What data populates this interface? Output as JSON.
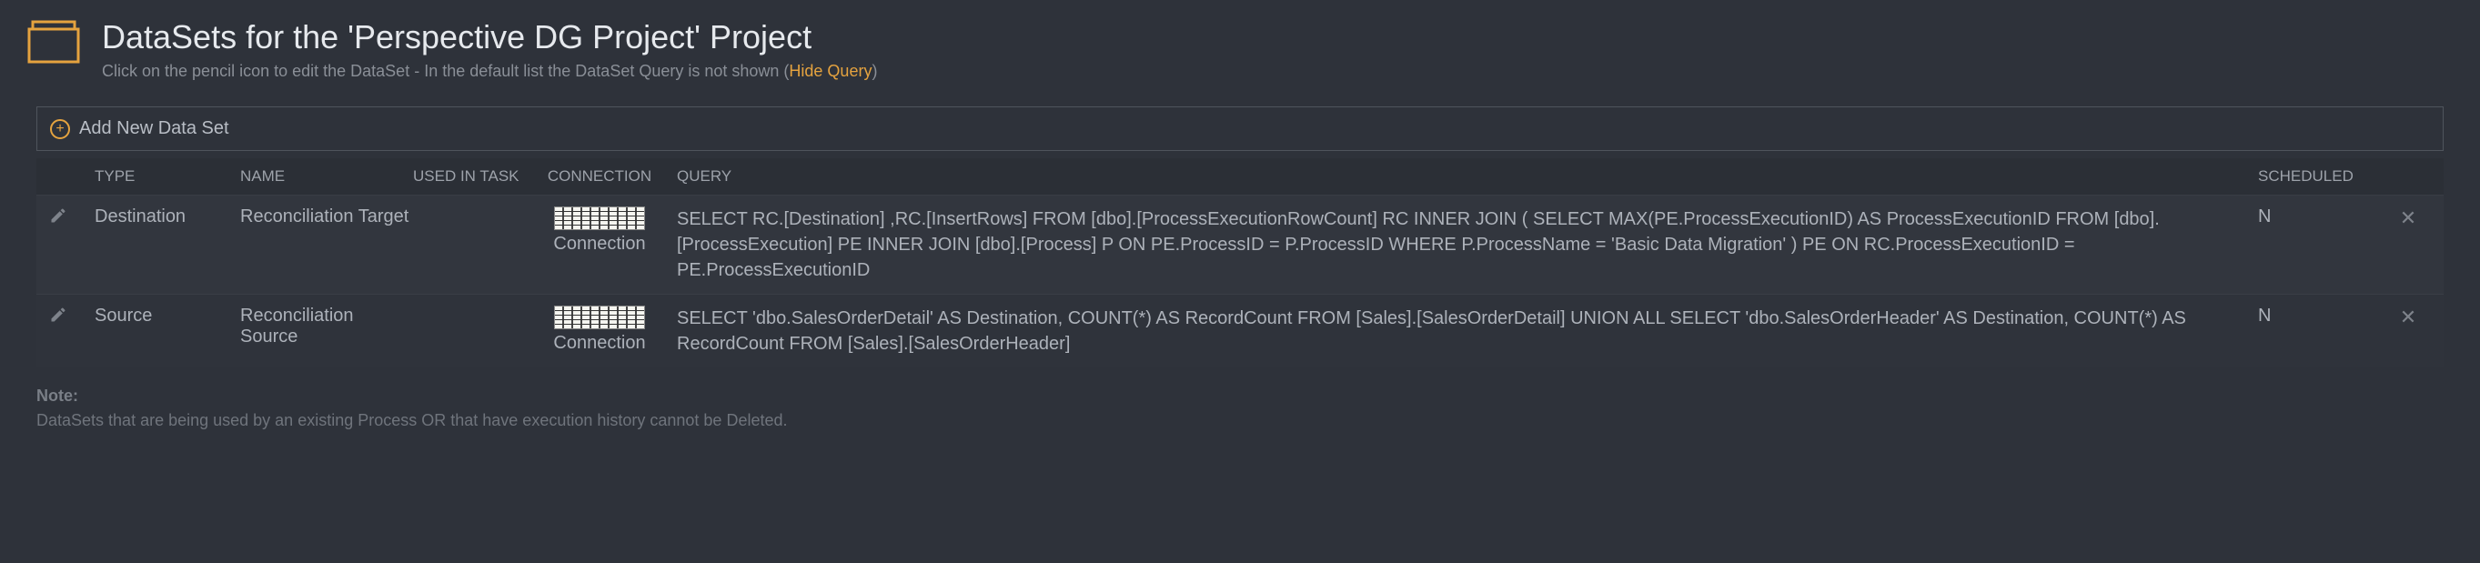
{
  "header": {
    "title": "DataSets for the 'Perspective DG Project' Project",
    "subtitle_prefix": "Click on the pencil icon to edit the DataSet - In the default list the DataSet Query is not shown (",
    "subtitle_link": "Hide Query",
    "subtitle_suffix": ")"
  },
  "toolbar": {
    "add_label": "Add New Data Set"
  },
  "table": {
    "headers": {
      "type": "TYPE",
      "name": "NAME",
      "used_in": "USED IN TASK",
      "connection": "CONNECTION",
      "query": "QUERY",
      "scheduled": "SCHEDULED"
    },
    "rows": [
      {
        "type": "Destination",
        "name": "Reconciliation Target",
        "used_in": "",
        "connection_label": "Connection",
        "query": "SELECT RC.[Destination] ,RC.[InsertRows] FROM [dbo].[ProcessExecutionRowCount] RC INNER JOIN ( SELECT MAX(PE.ProcessExecutionID) AS ProcessExecutionID FROM [dbo].[ProcessExecution] PE INNER JOIN [dbo].[Process] P ON PE.ProcessID = P.ProcessID WHERE P.ProcessName = 'Basic Data Migration' ) PE ON RC.ProcessExecutionID = PE.ProcessExecutionID",
        "scheduled": "N"
      },
      {
        "type": "Source",
        "name": "Reconciliation Source",
        "used_in": "",
        "connection_label": "Connection",
        "query": "SELECT 'dbo.SalesOrderDetail' AS Destination, COUNT(*) AS RecordCount FROM [Sales].[SalesOrderDetail] UNION ALL SELECT 'dbo.SalesOrderHeader' AS Destination, COUNT(*) AS RecordCount FROM [Sales].[SalesOrderHeader]",
        "scheduled": "N"
      }
    ]
  },
  "note": {
    "label": "Note:",
    "text": "DataSets that are being used by an existing Process OR that have execution history cannot be Deleted."
  }
}
